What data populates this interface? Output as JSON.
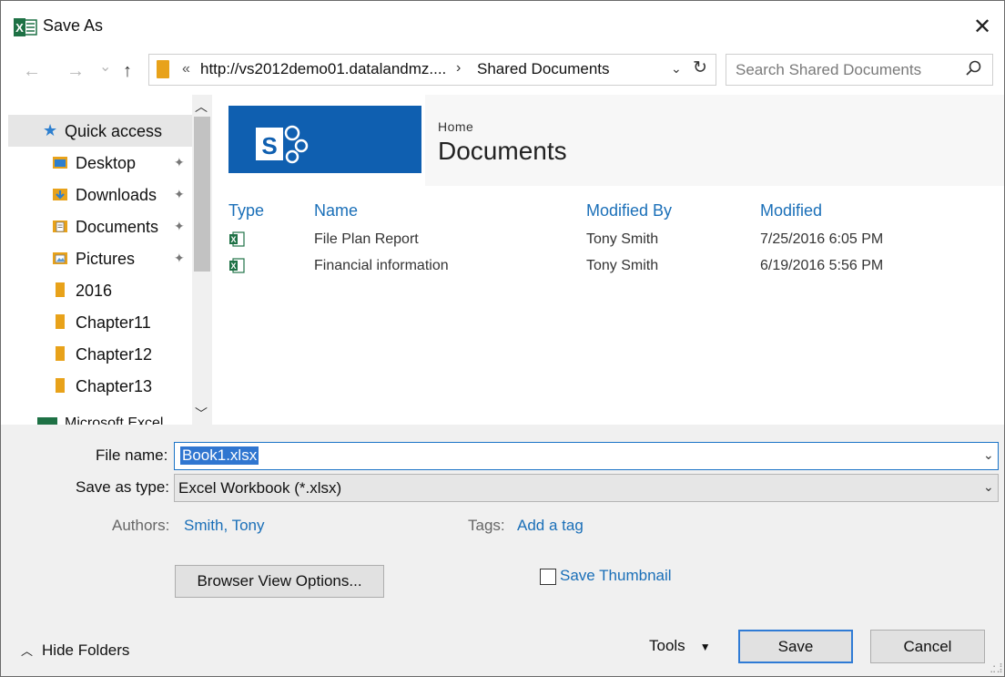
{
  "window": {
    "title": "Save As",
    "close_glyph": "✕",
    "app_icon": "excel-icon"
  },
  "nav": {
    "back": "←",
    "forward": "→",
    "recent": "⌄",
    "up": "↑"
  },
  "address": {
    "chevron": "«",
    "path": "http://vs2012demo01.datalandmz....",
    "separator": "›",
    "current": "Shared Documents",
    "dropdown": "⌄",
    "refresh": "↻"
  },
  "search": {
    "placeholder": "Search Shared Documents",
    "value": ""
  },
  "sidebar": {
    "quick_access": "Quick access",
    "items": [
      {
        "label": "Desktop",
        "icon": "desktop-folder-icon",
        "pinned": true
      },
      {
        "label": "Downloads",
        "icon": "downloads-folder-icon",
        "pinned": true
      },
      {
        "label": "Documents",
        "icon": "documents-folder-icon",
        "pinned": true
      },
      {
        "label": "Pictures",
        "icon": "pictures-folder-icon",
        "pinned": true
      },
      {
        "label": "2016",
        "icon": "folder-icon",
        "pinned": false
      },
      {
        "label": "Chapter11",
        "icon": "folder-icon",
        "pinned": false
      },
      {
        "label": "Chapter12",
        "icon": "folder-icon",
        "pinned": false
      },
      {
        "label": "Chapter13",
        "icon": "folder-icon",
        "pinned": false
      }
    ],
    "pin_glyph": "📌",
    "partial_item": "Microsoft Excel"
  },
  "library": {
    "breadcrumb": "Home",
    "title": "Documents",
    "columns": [
      "Type",
      "Name",
      "Modified By",
      "Modified"
    ],
    "rows": [
      {
        "name": "File Plan Report",
        "modified_by": "Tony Smith",
        "modified": "7/25/2016 6:05 PM"
      },
      {
        "name": "Financial information",
        "modified_by": "Tony Smith",
        "modified": "6/19/2016 5:56 PM"
      }
    ]
  },
  "form": {
    "file_name_label": "File name:",
    "file_name_value": "Book1.xlsx",
    "save_type_label": "Save as type:",
    "save_type_value": "Excel Workbook (*.xlsx)",
    "authors_label": "Authors:",
    "authors_value": "Smith, Tony",
    "tags_label": "Tags:",
    "tags_value": "Add a tag",
    "browser_view_button": "Browser View Options...",
    "save_thumbnail_label": "Save Thumbnail",
    "save_thumbnail_checked": false
  },
  "footer": {
    "hide_folders": "Hide Folders",
    "tools": "Tools",
    "save": "Save",
    "cancel": "Cancel"
  },
  "colors": {
    "accent": "#1a6fb8",
    "sharepoint_blue": "#0f5fb0",
    "excel_green": "#1e7145",
    "selection": "#3076d0"
  }
}
